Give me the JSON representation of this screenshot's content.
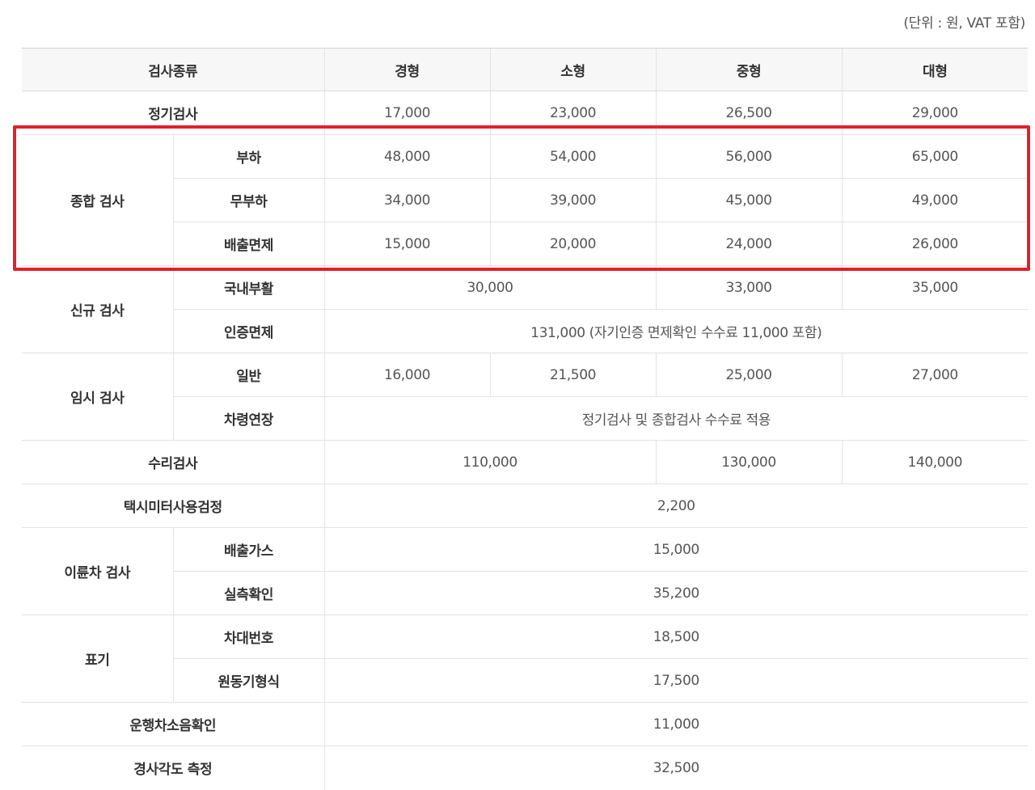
{
  "unit_note": "(단위 : 원, VAT 포함)",
  "header": {
    "type": "검사종류",
    "light": "경형",
    "small": "소형",
    "medium": "중형",
    "large": "대형"
  },
  "rows": {
    "regular": {
      "label": "정기검사",
      "values": [
        "17,000",
        "23,000",
        "26,500",
        "29,000"
      ]
    },
    "comprehensive": {
      "label": "종합 검사",
      "load": {
        "label": "부하",
        "values": [
          "48,000",
          "54,000",
          "56,000",
          "65,000"
        ]
      },
      "noload": {
        "label": "무부하",
        "values": [
          "34,000",
          "39,000",
          "45,000",
          "49,000"
        ]
      },
      "exempt": {
        "label": "배출면제",
        "values": [
          "15,000",
          "20,000",
          "24,000",
          "26,000"
        ]
      }
    },
    "new": {
      "label": "신규 검사",
      "domestic": {
        "label": "국내부활",
        "values": [
          "30,000",
          "33,000",
          "35,000"
        ]
      },
      "cert": {
        "label": "인증면제",
        "value": "131,000 (자기인증 면제확인 수수료 11,000 포함)"
      }
    },
    "temp": {
      "label": "임시 검사",
      "general": {
        "label": "일반",
        "values": [
          "16,000",
          "21,500",
          "25,000",
          "27,000"
        ]
      },
      "extend": {
        "label": "차령연장",
        "value": "정기검사 및 종합검사 수수료 적용"
      }
    },
    "repair": {
      "label": "수리검사",
      "values": [
        "110,000",
        "130,000",
        "140,000"
      ]
    },
    "taxi": {
      "label": "택시미터사용검정",
      "value": "2,200"
    },
    "twowheel": {
      "label": "이륜차 검사",
      "gas": {
        "label": "배출가스",
        "value": "15,000"
      },
      "measure": {
        "label": "실측확인",
        "value": "35,200"
      }
    },
    "marking": {
      "label": "표기",
      "vin": {
        "label": "차대번호",
        "value": "18,500"
      },
      "engine": {
        "label": "원동기형식",
        "value": "17,500"
      }
    },
    "noise": {
      "label": "운행차소음확인",
      "value": "11,000"
    },
    "tilt": {
      "label": "경사각도 측정",
      "value": "32,500"
    }
  },
  "colors": {
    "highlight": "#e3202b",
    "header_bg": "#f7f7f7",
    "border": "#e2e2e2"
  }
}
